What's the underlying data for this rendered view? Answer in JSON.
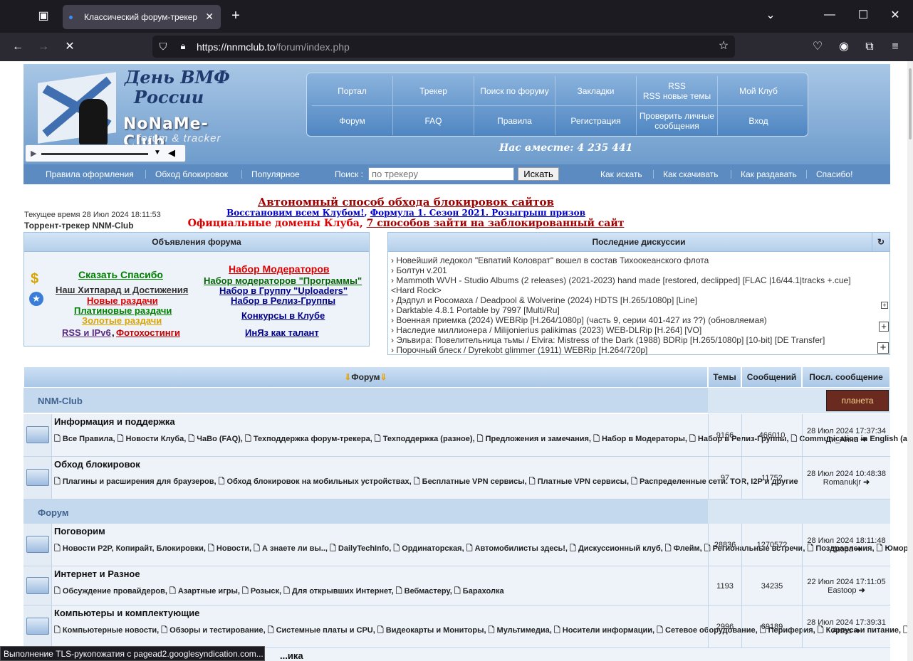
{
  "browser": {
    "tab_title": "Классический форум-трекер",
    "url_host": "https://nnmclub.to",
    "url_path": "/forum/index.php",
    "status": "Выполнение TLS-рукопожатия с pagead2.googlesyndication.com..."
  },
  "header": {
    "logo_line1": "День ВМФ",
    "logo_line2": "России",
    "logo_line3": "NoNaMe-Club",
    "logo_line4": "forum & tracker",
    "vmeste": "Нас вместе: 4 235 441",
    "nav": [
      [
        "Портал",
        "Трекер",
        "Поиск по форуму",
        "Закладки",
        "RSS\nRSS новые темы",
        "Мой Клуб"
      ],
      [
        "Форум",
        "FAQ",
        "Правила",
        "Регистрация",
        "Проверить личные сообщения",
        "Вход"
      ]
    ]
  },
  "linkbar": {
    "left": [
      "Правила оформления",
      "Обход блокировок",
      "Популярное"
    ],
    "search_label": "Поиск :",
    "search_placeholder": "по трекеру",
    "search_button": "Искать",
    "right": [
      "Как искать",
      "Как скачивать",
      "Как раздавать",
      "Спасибо!"
    ]
  },
  "announce": {
    "line1": "Автономный способ обхода блокировок сайтов",
    "line2a": "Восстановим всем Клубом!",
    "line2b": "Формула 1. Сезон 2021. Розыгрыш призов",
    "line3a": "Официальные домены Клуба",
    "line3b": "7 способов зайти на заблокированный сайт",
    "time": "Текущее время 28 Июл 2024 18:11:53",
    "tracker": "Торрент-трекер NNM-Club"
  },
  "ads": {
    "title": "Объявления форума",
    "left": [
      "Сказать Спасибо",
      "Наш Хитпарад и Достижения",
      "Новые раздачи",
      "Платиновые раздачи",
      "Золотые раздачи",
      "RSS и IPv6",
      "Фотохостинги"
    ],
    "right": [
      "Набор Модераторов",
      "Набор модераторов \"Программы\"",
      "Набор в Группу \"Uploaders\"",
      "Набор в Релиз-Группы",
      "Конкурсы в Клубе",
      "ИнЯз как талант"
    ]
  },
  "discussions": {
    "title": "Последние дискуссии",
    "items": [
      "› Новейший ледокол \"Евпатий Коловрат\" вошел в состав Тихоокеанского флота",
      "› Болтун v.201",
      "› Mammoth WVH - Studio Albums (2 releases) (2021-2023) hand made [restored, declipped] [FLAC |16/44.1|tracks +.cue]",
      "  <Hard Rock>",
      "› Дэдпул и Росомаха / Deadpool & Wolverine (2024) HDTS [H.265/1080p] [Line]",
      "› Darktable 4.8.1 Portable by 7997 [Multi/Ru]",
      "› Военная приемка (2024) WEBRip [H.264/1080p] (часть 9, серии 401-427 из ??) (обновляемая)",
      "› Наследие миллионера / Milijonierius palikimas (2023) WEB-DLRip [H.264] [VO]",
      "› Эльвира: Повелительница тьмы / Elvira: Mistress of the Dark (1988) BDRip [H.265/1080p] [10-bit] [DE Transfer]",
      "› Порочный блеск / Dyrekobt glimmer (1911) WEBRip [H.264/720p]"
    ]
  },
  "forum": {
    "head": "Форум",
    "col_topics": "Темы",
    "col_posts": "Сообщений",
    "col_last": "Посл. сообщение",
    "badge": "планета",
    "cats": [
      {
        "name": "NNM-Club"
      },
      {
        "name": "Форум"
      }
    ],
    "rows": [
      {
        "title": "Информация и поддержка",
        "subs": "Все Правила, | Новости Клуба, | ЧаВо (FAQ), | Техподдержка форум-трекера, | Техподдержка (разное), | Предложения и замечания, | Набор в Модераторы, | Набор в Релиз-Группы, | Communication in English (any questions), | Общий форум",
        "topics": "9166",
        "posts": "466010",
        "date": "28 Июл 2024 17:37:34",
        "user": "Ди_Анна"
      },
      {
        "title": "Обход блокировок",
        "subs": "Плагины и расширения для браузеров, | Обход блокировок на мобильных устройствах, | Бесплатные VPN сервисы, | Платные VPN сервисы, | Распределенные сети. TOR, I2P и другие",
        "topics": "97",
        "posts": "11752",
        "date": "28 Июл 2024 10:48:38",
        "user": "Romanukjr"
      },
      {
        "title": "Поговорим",
        "subs": "Новости P2P, Копирайт, Блокировки, | Новости, | А знаете ли вы.., | DailyTechInfo, | Ординаторская, | Автомобилисты здесь!, | Дискуссионный клуб, | Флейм, | Региональные встречи, | Поздравления, | Юмор",
        "topics": "28836",
        "posts": "1270572",
        "date": "28 Июл 2024 18:11:48",
        "user": "Yuopa"
      },
      {
        "title": "Интернет и Разное",
        "subs": "Обсуждение провайдеров, | Азартные игры, | Розыск, | Для открывших Интернет, | Вебмастеру, | Барахолка",
        "topics": "1193",
        "posts": "34235",
        "date": "22 Июл 2024 17:11:05",
        "user": "Eastoop"
      },
      {
        "title": "Компьютеры и комплектующие",
        "subs": "Компьютерные новости, | Обзоры и тестирование, | Системные платы и CPU, | Видеокарты и Мониторы, | Мультимедиа, | Носители информации, | Сетевое оборудование, | Периферия, | Корпуса и питание, | Комплексные вопросы, | Мобильные ПК",
        "topics": "2996",
        "posts": "69189",
        "date": "28 Июл 2024 17:39:31",
        "user": "Arsss"
      },
      {
        "title": "...ика",
        "subs": "",
        "topics": "",
        "posts": "",
        "date": "",
        "user": ""
      }
    ]
  }
}
